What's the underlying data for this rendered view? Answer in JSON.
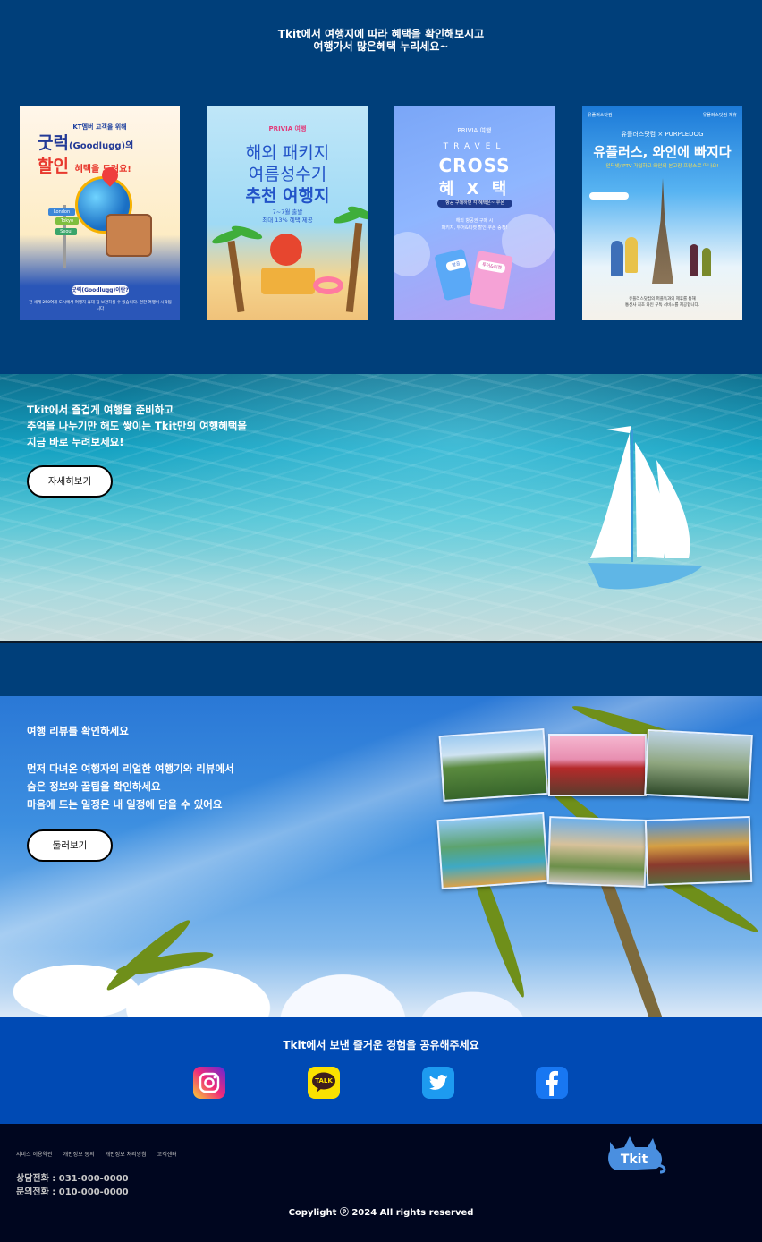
{
  "top": {
    "heading_line1": "Tkit에서 여행지에 따라 혜택을 확인해보시고",
    "heading_line2": "여행가서 많은혜택 누리세요~"
  },
  "cards": [
    {
      "small": "KT멤버 고객을 위해",
      "title_main": "굿럭",
      "title_sub": "(Goodlugg)의",
      "title_red": "할인",
      "title_rest": "혜택을 드려요!",
      "signs": [
        "London",
        "Tokyo",
        "Seoul"
      ],
      "pill": "굿럭(Goodlugg)이란?",
      "foot": "전 세계 250여개 도시에서 여행자 휴대 짐 보관하실 수 있습니다. 편한 여행이 시작됩니다"
    },
    {
      "brand": "PRIVIA 여행",
      "title1": "해외 패키지",
      "title2": "여름성수기",
      "title3": "추천 여행지",
      "sub1": "7~7월 출발",
      "sub2": "최대 13% 혜택 제공"
    },
    {
      "brand": "PRIVIA 여행",
      "travel": "TRAVEL",
      "cross": "CROSS",
      "hx": "혜 X 택",
      "bar": "항공 구매하면 각 혜택은~ 쿠폰",
      "desc1": "해외 항공권 구매 시",
      "desc2": "패키지, 투어&티켓 할인 쿠폰 증정!",
      "tag1": "항공",
      "tag2": "투어&티켓"
    },
    {
      "brand_left": "유플러스닷컴",
      "brand_right": "유플러스닷컴 제휴",
      "collab": "유플러스닷컴 × PURPLEDOG",
      "title": "유플러스, 와인에 빠지다",
      "sub": "인터넷/IPTV 가입하고 와인의 본고장 프랑스로 떠나요!",
      "foot1": "유플러스닷컴의 퍼플독과의 제휴를 통해",
      "foot2": "통신사 최초 와인 구독 서비스를 제공합니다."
    }
  ],
  "sea": {
    "line1": "Tkit에서 즐겁게 여행을 준비하고",
    "line2": "추억을 나누기만 해도 쌓이는 Tkit만의 여행혜택을",
    "line3": "지금 바로 누려보세요!",
    "button": "자세히보기"
  },
  "reviews": {
    "title": "여행 리뷰를 확인하세요",
    "line1": "먼저 다녀온 여행자의 리얼한 여행기와 리뷰에서",
    "line2": "숨은 정보와 꿀팁을 확인하세요",
    "line3": "마음에 드는 일정은 내 일정에 담을 수 있어요",
    "button": "둘러보기"
  },
  "share": {
    "title": "Tkit에서 보낸 즐거운 경험을 공유해주세요",
    "icons": [
      "instagram-icon",
      "kakaotalk-icon",
      "twitter-icon",
      "facebook-icon"
    ],
    "kakao_label": "TALK"
  },
  "footer": {
    "links": [
      "서비스 이용약관",
      "개인정보 동의",
      "개인정보 처리방침",
      "고객센터"
    ],
    "phone1": "상담전화 : 031-000-0000",
    "phone2": "문의전화 : 010-000-0000",
    "copyright": "Copylight ⓟ 2024 All rights reserved",
    "logo": "Tkit"
  },
  "colors": {
    "navy": "#003f7a",
    "share_blue": "#004ab4",
    "footer_bg": "#00061f"
  }
}
